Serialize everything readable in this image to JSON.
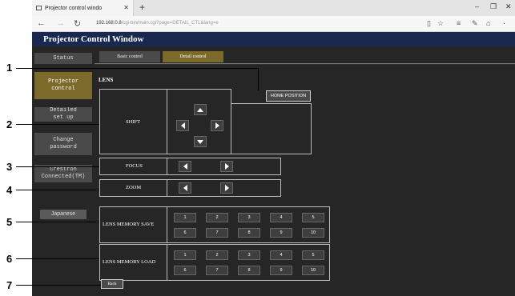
{
  "browser": {
    "tab_title": "Projector control windo",
    "url_host": "192.168.0.8",
    "url_path": "/cgi-bin/main.cgi?page=DETAIL_CTL&lang=e"
  },
  "app": {
    "title": "Projector Control Window"
  },
  "sidebar": {
    "items": [
      {
        "label": "Status"
      },
      {
        "label": "Projector\ncontrol"
      },
      {
        "label": "Detailed\nset up"
      },
      {
        "label": "Change\npassword"
      },
      {
        "label": "Crestron\nConnected(TM)"
      },
      {
        "label": "Japanese"
      }
    ]
  },
  "tabs": {
    "basic": "Basic control",
    "detail": "Detail control"
  },
  "lens": {
    "title": "LENS",
    "home_position": "HOME POSITION",
    "shift_label": "SHIFT",
    "focus_label": "FOCUS",
    "zoom_label": "ZOOM",
    "memory_save_label": "LENS MEMORY SAVE",
    "memory_load_label": "LENS MEMORY LOAD",
    "memory_numbers": [
      "1",
      "2",
      "3",
      "4",
      "5",
      "6",
      "7",
      "8",
      "9",
      "10"
    ],
    "back": "Back"
  },
  "callouts": [
    "1",
    "2",
    "3",
    "4",
    "5",
    "6",
    "7"
  ]
}
